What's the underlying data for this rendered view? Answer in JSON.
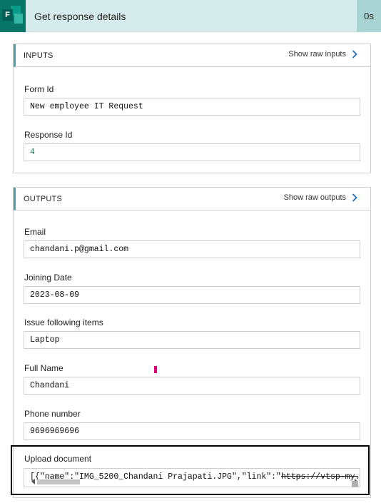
{
  "header": {
    "app_icon_letter": "F",
    "title": "Get response details",
    "duration": "0s"
  },
  "inputs": {
    "title": "INPUTS",
    "raw_link": "Show raw inputs",
    "fields": [
      {
        "label": "Form Id",
        "value": "New employee IT Request"
      },
      {
        "label": "Response Id",
        "value": "4"
      }
    ]
  },
  "outputs": {
    "title": "OUTPUTS",
    "raw_link": "Show raw outputs",
    "fields": [
      {
        "label": "Email",
        "value": "chandani.p@gmail.com"
      },
      {
        "label": "Joining Date",
        "value": "2023-08-09"
      },
      {
        "label": "Issue following items",
        "value": "Laptop"
      },
      {
        "label": "Full Name",
        "value": "Chandani"
      },
      {
        "label": "Phone number",
        "value": "9696969696"
      },
      {
        "label": "Upload document",
        "value": "[{\"name\":\"IMG_5200_Chandani Prajapati.JPG\",\"link\":\"https://vtsp-my."
      }
    ]
  },
  "colors": {
    "header_bg": "#d6ecec",
    "icon_bg": "#077568",
    "accent_border": "#4f9fb0",
    "link_chevron": "#1a6fc4"
  },
  "icons": {
    "app": "forms-app-icon",
    "chevron": "chevron-right-icon"
  }
}
